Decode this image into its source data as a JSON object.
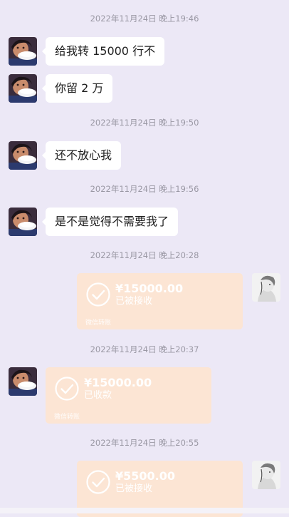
{
  "messages": [
    {
      "type": "timestamp",
      "text": "2022年11月24日 晚上19:46"
    },
    {
      "type": "text",
      "side": "left",
      "text": "给我转 15000 行不"
    },
    {
      "type": "text",
      "side": "left",
      "text": "你留 2 万"
    },
    {
      "type": "timestamp",
      "text": "2022年11月24日 晚上19:50"
    },
    {
      "type": "text",
      "side": "left",
      "text": "还不放心我"
    },
    {
      "type": "timestamp",
      "text": "2022年11月24日 晚上19:56"
    },
    {
      "type": "text",
      "side": "left",
      "text": "是不是觉得不需要我了"
    },
    {
      "type": "timestamp",
      "text": "2022年11月24日 晚上20:28"
    },
    {
      "type": "transfer",
      "side": "right",
      "amount": "¥15000.00",
      "status": "已被接收",
      "footer": "微信转账"
    },
    {
      "type": "timestamp",
      "text": "2022年11月24日 晚上20:37"
    },
    {
      "type": "transfer",
      "side": "left",
      "amount": "¥15000.00",
      "status": "已收款",
      "footer": "微信转账"
    },
    {
      "type": "timestamp",
      "text": "2022年11月24日 晚上20:55"
    },
    {
      "type": "transfer",
      "side": "right",
      "amount": "¥5500.00",
      "status": "已被接收",
      "footer": ""
    }
  ],
  "colors": {
    "background": "#ECE8F6",
    "bubble": "#FFFFFF",
    "transfer_card": "#FCE5D4"
  },
  "icons": {
    "transfer_status": "check-circle-icon",
    "left_avatar": "contact-avatar",
    "right_avatar": "self-avatar"
  }
}
